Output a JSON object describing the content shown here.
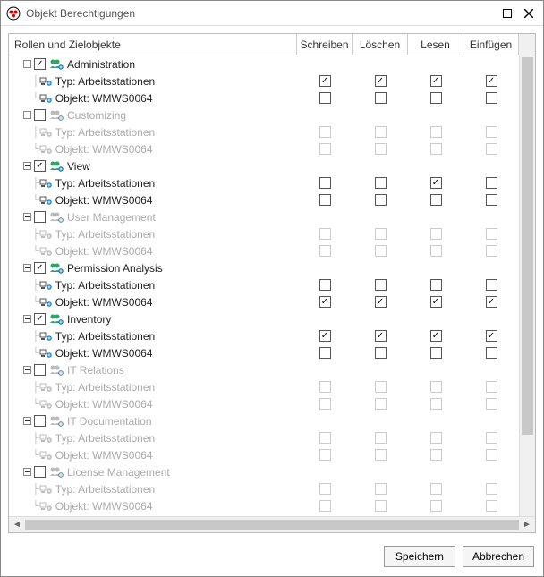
{
  "window": {
    "title": "Objekt Berechtigungen"
  },
  "columns": {
    "tree": "Rollen und Zielobjekte",
    "write": "Schreiben",
    "delete": "Löschen",
    "read": "Lesen",
    "insert": "Einfügen"
  },
  "buttons": {
    "save": "Speichern",
    "cancel": "Abbrechen"
  },
  "roles": [
    {
      "name": "Administration",
      "checked": true,
      "enabled": true,
      "children": [
        {
          "label": "Typ: Arbeitsstationen",
          "kind": "type",
          "perms": {
            "write": true,
            "delete": true,
            "read": true,
            "insert": true
          }
        },
        {
          "label": "Objekt: WMWS0064",
          "kind": "object",
          "perms": {
            "write": false,
            "delete": false,
            "read": false,
            "insert": false
          }
        }
      ]
    },
    {
      "name": "Customizing",
      "checked": false,
      "enabled": false,
      "children": [
        {
          "label": "Typ: Arbeitsstationen",
          "kind": "type",
          "perms": {
            "write": false,
            "delete": false,
            "read": false,
            "insert": false
          }
        },
        {
          "label": "Objekt: WMWS0064",
          "kind": "object",
          "perms": {
            "write": false,
            "delete": false,
            "read": false,
            "insert": false
          }
        }
      ]
    },
    {
      "name": "View",
      "checked": true,
      "enabled": true,
      "children": [
        {
          "label": "Typ: Arbeitsstationen",
          "kind": "type",
          "perms": {
            "write": false,
            "delete": false,
            "read": true,
            "insert": false
          }
        },
        {
          "label": "Objekt: WMWS0064",
          "kind": "object",
          "perms": {
            "write": false,
            "delete": false,
            "read": false,
            "insert": false
          }
        }
      ]
    },
    {
      "name": "User Management",
      "checked": false,
      "enabled": false,
      "children": [
        {
          "label": "Typ: Arbeitsstationen",
          "kind": "type",
          "perms": {
            "write": false,
            "delete": false,
            "read": false,
            "insert": false
          }
        },
        {
          "label": "Objekt: WMWS0064",
          "kind": "object",
          "perms": {
            "write": false,
            "delete": false,
            "read": false,
            "insert": false
          }
        }
      ]
    },
    {
      "name": "Permission Analysis",
      "checked": true,
      "enabled": true,
      "children": [
        {
          "label": "Typ: Arbeitsstationen",
          "kind": "type",
          "perms": {
            "write": false,
            "delete": false,
            "read": false,
            "insert": false
          }
        },
        {
          "label": "Objekt: WMWS0064",
          "kind": "object",
          "perms": {
            "write": true,
            "delete": true,
            "read": true,
            "insert": true
          }
        }
      ]
    },
    {
      "name": "Inventory",
      "checked": true,
      "enabled": true,
      "children": [
        {
          "label": "Typ: Arbeitsstationen",
          "kind": "type",
          "perms": {
            "write": true,
            "delete": true,
            "read": true,
            "insert": true
          }
        },
        {
          "label": "Objekt: WMWS0064",
          "kind": "object",
          "perms": {
            "write": false,
            "delete": false,
            "read": false,
            "insert": false
          }
        }
      ]
    },
    {
      "name": "IT Relations",
      "checked": false,
      "enabled": false,
      "children": [
        {
          "label": "Typ: Arbeitsstationen",
          "kind": "type",
          "perms": {
            "write": false,
            "delete": false,
            "read": false,
            "insert": false
          }
        },
        {
          "label": "Objekt: WMWS0064",
          "kind": "object",
          "perms": {
            "write": false,
            "delete": false,
            "read": false,
            "insert": false
          }
        }
      ]
    },
    {
      "name": "IT Documentation",
      "checked": false,
      "enabled": false,
      "children": [
        {
          "label": "Typ: Arbeitsstationen",
          "kind": "type",
          "perms": {
            "write": false,
            "delete": false,
            "read": false,
            "insert": false
          }
        },
        {
          "label": "Objekt: WMWS0064",
          "kind": "object",
          "perms": {
            "write": false,
            "delete": false,
            "read": false,
            "insert": false
          }
        }
      ]
    },
    {
      "name": "License Management",
      "checked": false,
      "enabled": false,
      "children": [
        {
          "label": "Typ: Arbeitsstationen",
          "kind": "type",
          "perms": {
            "write": false,
            "delete": false,
            "read": false,
            "insert": false
          }
        },
        {
          "label": "Objekt: WMWS0064",
          "kind": "object",
          "perms": {
            "write": false,
            "delete": false,
            "read": false,
            "insert": false
          }
        }
      ]
    }
  ]
}
